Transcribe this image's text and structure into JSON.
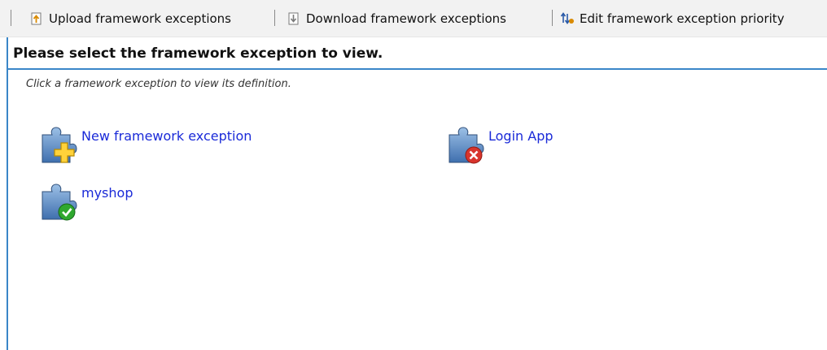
{
  "toolbar": {
    "upload_label": "Upload framework exceptions",
    "download_label": "Download framework exceptions",
    "priority_label": "Edit framework exception priority",
    "icons": {
      "upload": "upload-arrow-icon",
      "download": "download-arrow-icon",
      "priority": "priority-arrows-icon"
    }
  },
  "header": {
    "title": "Please select the framework exception to view.",
    "hint": "Click a framework exception to view its definition."
  },
  "exceptions": [
    {
      "label": "New framework exception",
      "icon": "puzzle-add-icon",
      "status": "add"
    },
    {
      "label": "Login App",
      "icon": "puzzle-error-icon",
      "status": "error"
    },
    {
      "label": "myshop",
      "icon": "puzzle-ok-icon",
      "status": "ok"
    }
  ],
  "colors": {
    "accent": "#3a86c8",
    "link": "#1a2ad8",
    "toolbar_bg": "#f2f2f2"
  }
}
